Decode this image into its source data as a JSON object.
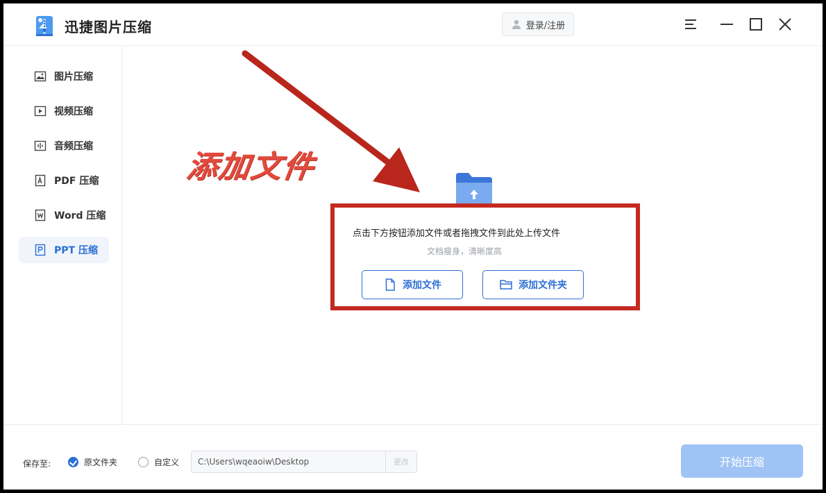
{
  "titlebar": {
    "app_title": "迅捷图片压缩",
    "login_label": "登录/注册"
  },
  "sidebar": {
    "items": [
      {
        "label": "图片压缩",
        "icon": "image-icon",
        "active": false
      },
      {
        "label": "视频压缩",
        "icon": "video-icon",
        "active": false
      },
      {
        "label": "音频压缩",
        "icon": "audio-icon",
        "active": false
      },
      {
        "label": "PDF 压缩",
        "icon": "pdf-icon",
        "active": false
      },
      {
        "label": "Word 压缩",
        "icon": "word-icon",
        "active": false
      },
      {
        "label": "PPT 压缩",
        "icon": "ppt-icon",
        "active": true
      }
    ]
  },
  "main": {
    "annotation": "添加文件",
    "upload_hint": "点击下方按钮添加文件或者拖拽文件到此处上传文件",
    "upload_sub": "文档瘦身，清晰度高",
    "add_file_label": "添加文件",
    "add_folder_label": "添加文件夹"
  },
  "footer": {
    "save_to_label": "保存至:",
    "option_original": "原文件夹",
    "option_custom": "自定义",
    "path_value": "C:\\Users\\wqeaoiw\\Desktop",
    "change_label": "更改",
    "start_label": "开始压缩"
  },
  "colors": {
    "accent": "#2b6fd6",
    "annotation_red": "#c42a20",
    "start_disabled": "#9fc3f5"
  }
}
